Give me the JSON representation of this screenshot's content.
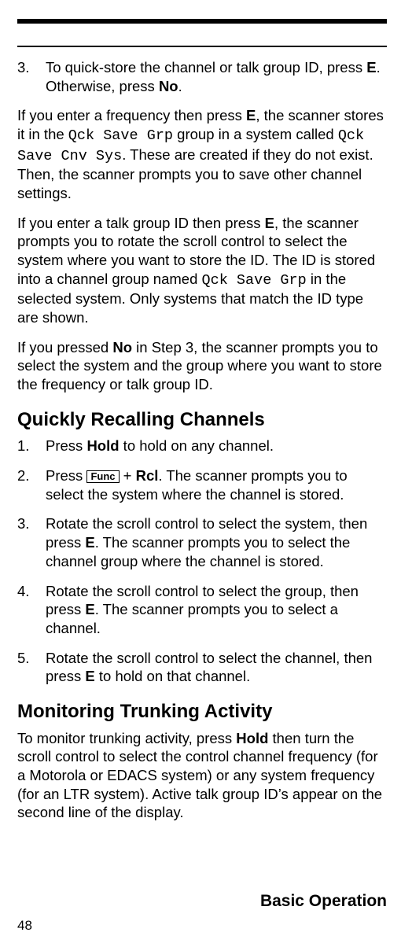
{
  "step3": {
    "num": "3.",
    "text_a": "To quick-store the channel or talk group ID, press ",
    "key_e": "E",
    "text_b": ". Otherwise, press ",
    "key_no": "No",
    "text_c": "."
  },
  "p1": {
    "a": "If you enter a frequency then press ",
    "key_e": "E",
    "b": ", the scanner stores it in the ",
    "code1": "Qck Save Grp",
    "c": " group in a system called ",
    "code2": "Qck Save Cnv Sys",
    "d": ". These are created if they do not exist. Then, the scanner prompts you to save other channel settings."
  },
  "p2": {
    "a": "If you enter a talk group ID then press ",
    "key_e": "E",
    "b": ", the scanner prompts you to rotate the scroll control to select the system where you want to store the ID. The ID is stored into a channel group named ",
    "code1": "Qck Save Grp",
    "c": " in the selected system. Only systems that match the ID type are shown."
  },
  "p3": {
    "a": "If you pressed ",
    "key_no": "No",
    "b": " in Step 3, the scanner prompts you to select the system and the group where you want to store the frequency or talk group ID."
  },
  "h2_recall": "Quickly Recalling Channels",
  "r_steps": {
    "s1": {
      "num": "1.",
      "a": "Press ",
      "key_hold": "Hold",
      "b": " to hold on any channel."
    },
    "s2": {
      "num": "2.",
      "a": "Press ",
      "func": "Func",
      "plus": " + ",
      "key_rcl": "Rcl",
      "b": ". The scanner prompts you to select the system where the channel is stored."
    },
    "s3": {
      "num": "3.",
      "a": "Rotate the scroll control to select the system, then press ",
      "key_e": "E",
      "b": ". The scanner prompts you to select the channel group where the channel is stored."
    },
    "s4": {
      "num": "4.",
      "a": "Rotate the scroll control to select the group, then press ",
      "key_e": "E",
      "b": ". The scanner prompts you to select a channel."
    },
    "s5": {
      "num": "5.",
      "a": "Rotate the scroll control to select the channel, then press ",
      "key_e": "E",
      "b": " to hold on that channel."
    }
  },
  "h2_monitor": "Monitoring Trunking Activity",
  "p_monitor": {
    "a": "To monitor trunking activity, press ",
    "key_hold": "Hold",
    "b": " then turn the scroll control to select the control channel frequency (for a Motorola or EDACS system) or any system frequency (for an LTR system). Active talk group ID’s appear on the second line of the display."
  },
  "footer_title": "Basic Operation",
  "page_number": "48"
}
